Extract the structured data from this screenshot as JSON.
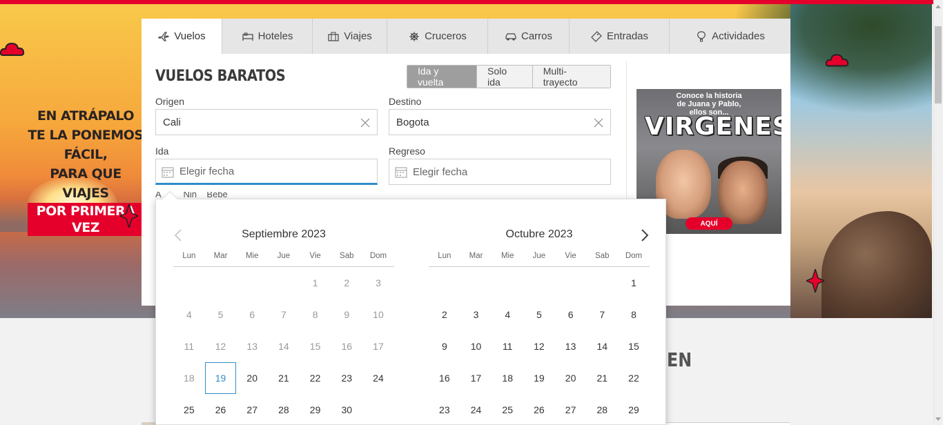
{
  "colors": {
    "brand_red": "#e5002b",
    "accent_blue": "#2f8bc9",
    "tab_bg": "#e6e6e6",
    "active_trip_bg": "#9e9e9e"
  },
  "promo": {
    "line1": "EN ATRÁPALO",
    "line2": "TE LA PONEMOS",
    "line3": "FÁCIL,",
    "line4": "PARA QUE VIAJES",
    "highlight": "POR PRIMERA VEZ"
  },
  "tabs": [
    {
      "label": "Vuelos",
      "icon": "plane-icon"
    },
    {
      "label": "Hoteles",
      "icon": "bed-icon"
    },
    {
      "label": "Viajes",
      "icon": "suitcase-icon"
    },
    {
      "label": "Cruceros",
      "icon": "ship-wheel-icon"
    },
    {
      "label": "Carros",
      "icon": "car-icon"
    },
    {
      "label": "Entradas",
      "icon": "ticket-icon"
    },
    {
      "label": "Actividades",
      "icon": "balloon-icon"
    }
  ],
  "search": {
    "title": "VUELOS BARATOS",
    "trip_types": [
      "Ida y vuelta",
      "Solo ida",
      "Multi-trayecto"
    ],
    "origin_label": "Origen",
    "origin_value": "Cali",
    "destination_label": "Destino",
    "destination_value": "Bogota",
    "depart_label": "Ida",
    "depart_placeholder": "Elegir fecha",
    "return_label": "Regreso",
    "return_placeholder": "Elegir fecha",
    "peek_text": "A         Niñ    Bebé"
  },
  "ad": {
    "headline_line1": "Conoce la historia",
    "headline_line2": "de Juana y Pablo,",
    "headline_line3": "ellos son...",
    "logo": "VIRGENES",
    "cta": "AQUÍ"
  },
  "datepicker": {
    "dow": [
      "Lun",
      "Mar",
      "Mie",
      "Jue",
      "Vie",
      "Sab",
      "Dom"
    ],
    "months": [
      {
        "title": "Septiembre 2023",
        "leading_blanks": 4,
        "days": 30,
        "past_until": 18,
        "today": 19
      },
      {
        "title": "Octubre 2023",
        "leading_blanks": 6,
        "days": 29,
        "past_until": 0,
        "today": 0
      }
    ]
  },
  "partial_heading": "EN"
}
